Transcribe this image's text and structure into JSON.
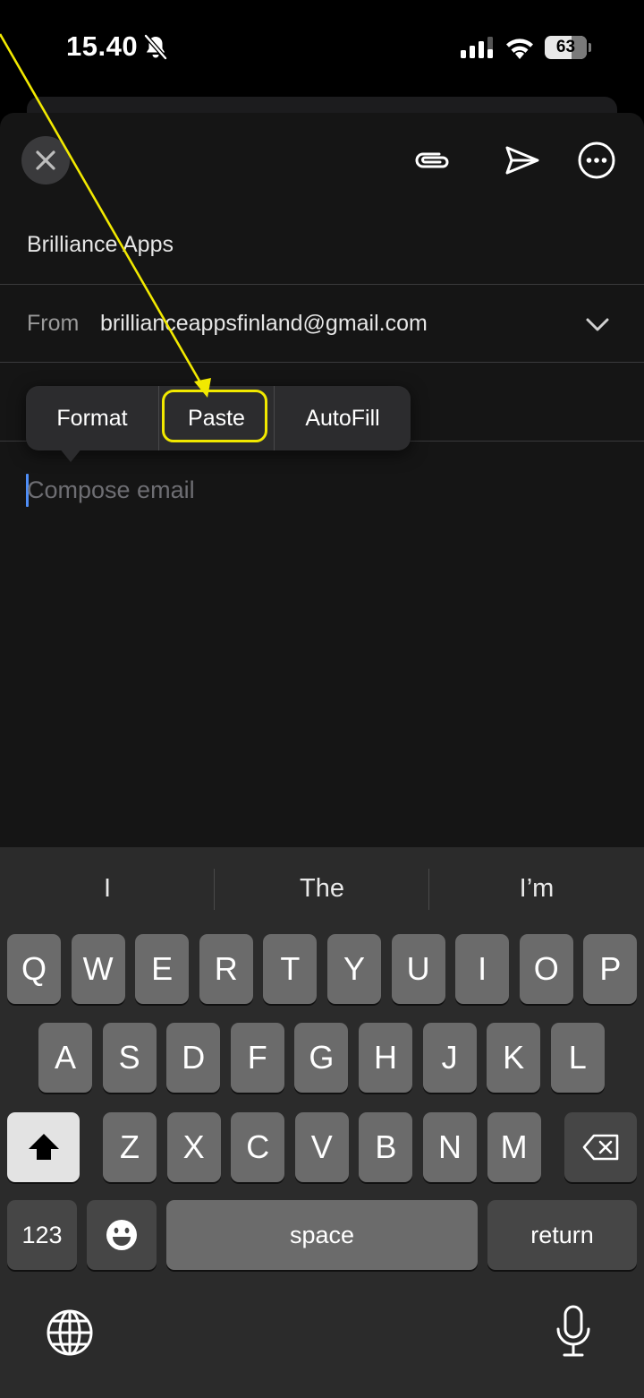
{
  "status_bar": {
    "time": "15.40",
    "battery_percent": "63",
    "battery_level": 0.63,
    "icons": [
      "bell-slash-icon",
      "cellular-signal-icon",
      "wifi-icon",
      "battery-icon"
    ]
  },
  "toolbar": {
    "close_icon": "close-icon",
    "attach_icon": "paperclip-icon",
    "send_icon": "send-icon",
    "more_icon": "ellipsis-circle-icon"
  },
  "compose": {
    "to_value": "Brilliance Apps",
    "from_label": "From",
    "from_value": "brillianceappsfinland@gmail.com",
    "body_placeholder": "Compose email"
  },
  "edit_menu": {
    "items": [
      {
        "label": "Format"
      },
      {
        "label": "Paste"
      },
      {
        "label": "AutoFill"
      }
    ],
    "highlighted": "Paste",
    "annotation_color": "#f2e900"
  },
  "keyboard": {
    "predictions": [
      "I",
      "The",
      "I’m"
    ],
    "row1": [
      "Q",
      "W",
      "E",
      "R",
      "T",
      "Y",
      "U",
      "I",
      "O",
      "P"
    ],
    "row2": [
      "A",
      "S",
      "D",
      "F",
      "G",
      "H",
      "J",
      "K",
      "L"
    ],
    "row3": [
      "Z",
      "X",
      "C",
      "V",
      "B",
      "N",
      "M"
    ],
    "numbers_label": "123",
    "space_label": "space",
    "return_label": "return"
  }
}
